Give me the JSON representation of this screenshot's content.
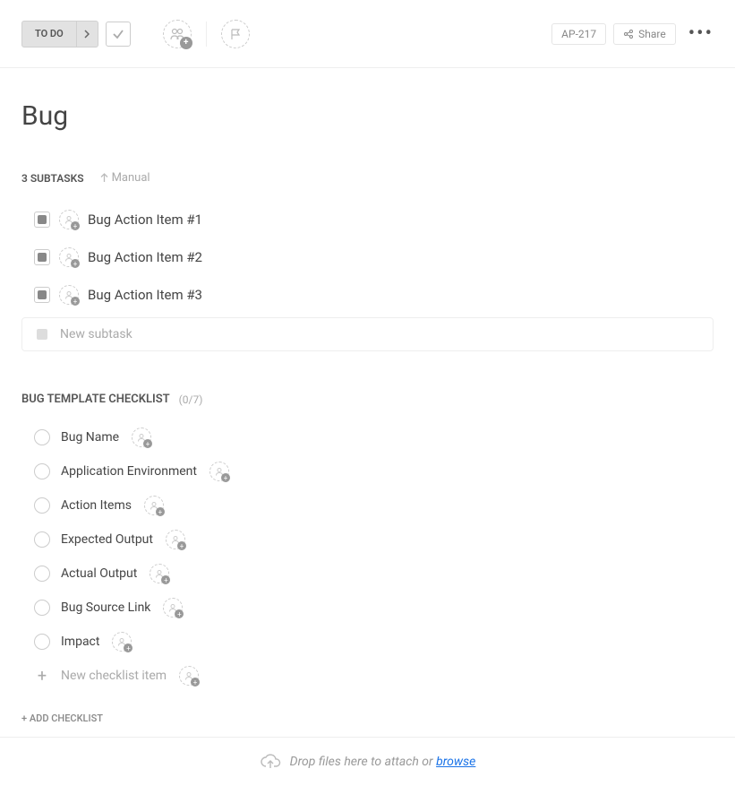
{
  "toolbar": {
    "status_label": "TO DO",
    "ticket_id": "AP-217",
    "share_label": "Share"
  },
  "title": "Bug",
  "subtasks_heading": "3 SUBTASKS",
  "sort_label": "Manual",
  "subtasks": [
    {
      "label": "Bug Action Item #1"
    },
    {
      "label": "Bug Action Item #2"
    },
    {
      "label": "Bug Action Item #3"
    }
  ],
  "new_subtask_placeholder": "New subtask",
  "checklist": {
    "title": "BUG TEMPLATE CHECKLIST",
    "count": "(0/7)",
    "items": [
      {
        "label": "Bug Name"
      },
      {
        "label": "Application Environment"
      },
      {
        "label": "Action Items"
      },
      {
        "label": "Expected Output"
      },
      {
        "label": "Actual Output"
      },
      {
        "label": "Bug Source Link"
      },
      {
        "label": "Impact"
      }
    ],
    "new_item_placeholder": "New checklist item",
    "add_checklist_label": "+ ADD CHECKLIST"
  },
  "dropzone": {
    "text_before": "Drop files here to attach or",
    "link_text": "browse"
  }
}
